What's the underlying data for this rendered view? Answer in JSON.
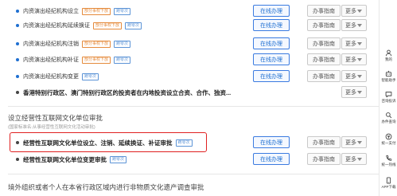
{
  "services": [
    {
      "title": "内资演出经纪机构设立",
      "tags": [
        "部分事权下放",
        "跑零次"
      ]
    },
    {
      "title": "内资演出经纪机构延续换证",
      "tags": [
        "部分事权下放",
        "跑零次"
      ]
    },
    {
      "title": "内资演出经纪机构注销",
      "tags": [
        "部分事权下放",
        "跑零次"
      ]
    },
    {
      "title": "内资演出经纪机构补证",
      "tags": [
        "部分事权下放",
        "跑零次"
      ]
    },
    {
      "title": "内资演出经纪机构变更",
      "tags": [
        "跑零次"
      ]
    },
    {
      "title": "香港特别行政区、澳门特别行政区的投资者在内地投资设立合资、合作、独资...",
      "tags": []
    }
  ],
  "group2": {
    "title": "设立经营性互联网文化单位审批",
    "subtitle": "(国家标准名:从事经营性互联网文化活动审批)",
    "items": [
      {
        "title": "经营性互联网文化单位设立、注销、延续换证、补证审批",
        "tags": [
          "跑零次"
        ]
      },
      {
        "title": "经营性互联网文化单位变更审批",
        "tags": [
          "跑零次"
        ]
      }
    ]
  },
  "group3": {
    "title": "境外组织或者个人在本省行政区域内进行非物质文化遗产调查审批"
  },
  "buttons": {
    "online": "在线办理",
    "guide": "办事指南",
    "more": "更多"
  },
  "sidebar": [
    {
      "label": "我的",
      "icon": "user-icon"
    },
    {
      "label": "智能助手",
      "icon": "robot-icon"
    },
    {
      "label": "咨询投诉",
      "icon": "chat-icon"
    },
    {
      "label": "办件查询",
      "icon": "search-doc-icon"
    },
    {
      "label": "统一支付",
      "icon": "pay-icon"
    },
    {
      "label": "统一热线",
      "icon": "phone-icon"
    },
    {
      "label": "APP下载",
      "icon": "app-icon"
    }
  ],
  "colors": {
    "accent": "#1f6fd1",
    "highlight": "#e02020",
    "tag_orange": "#e58a3b"
  }
}
